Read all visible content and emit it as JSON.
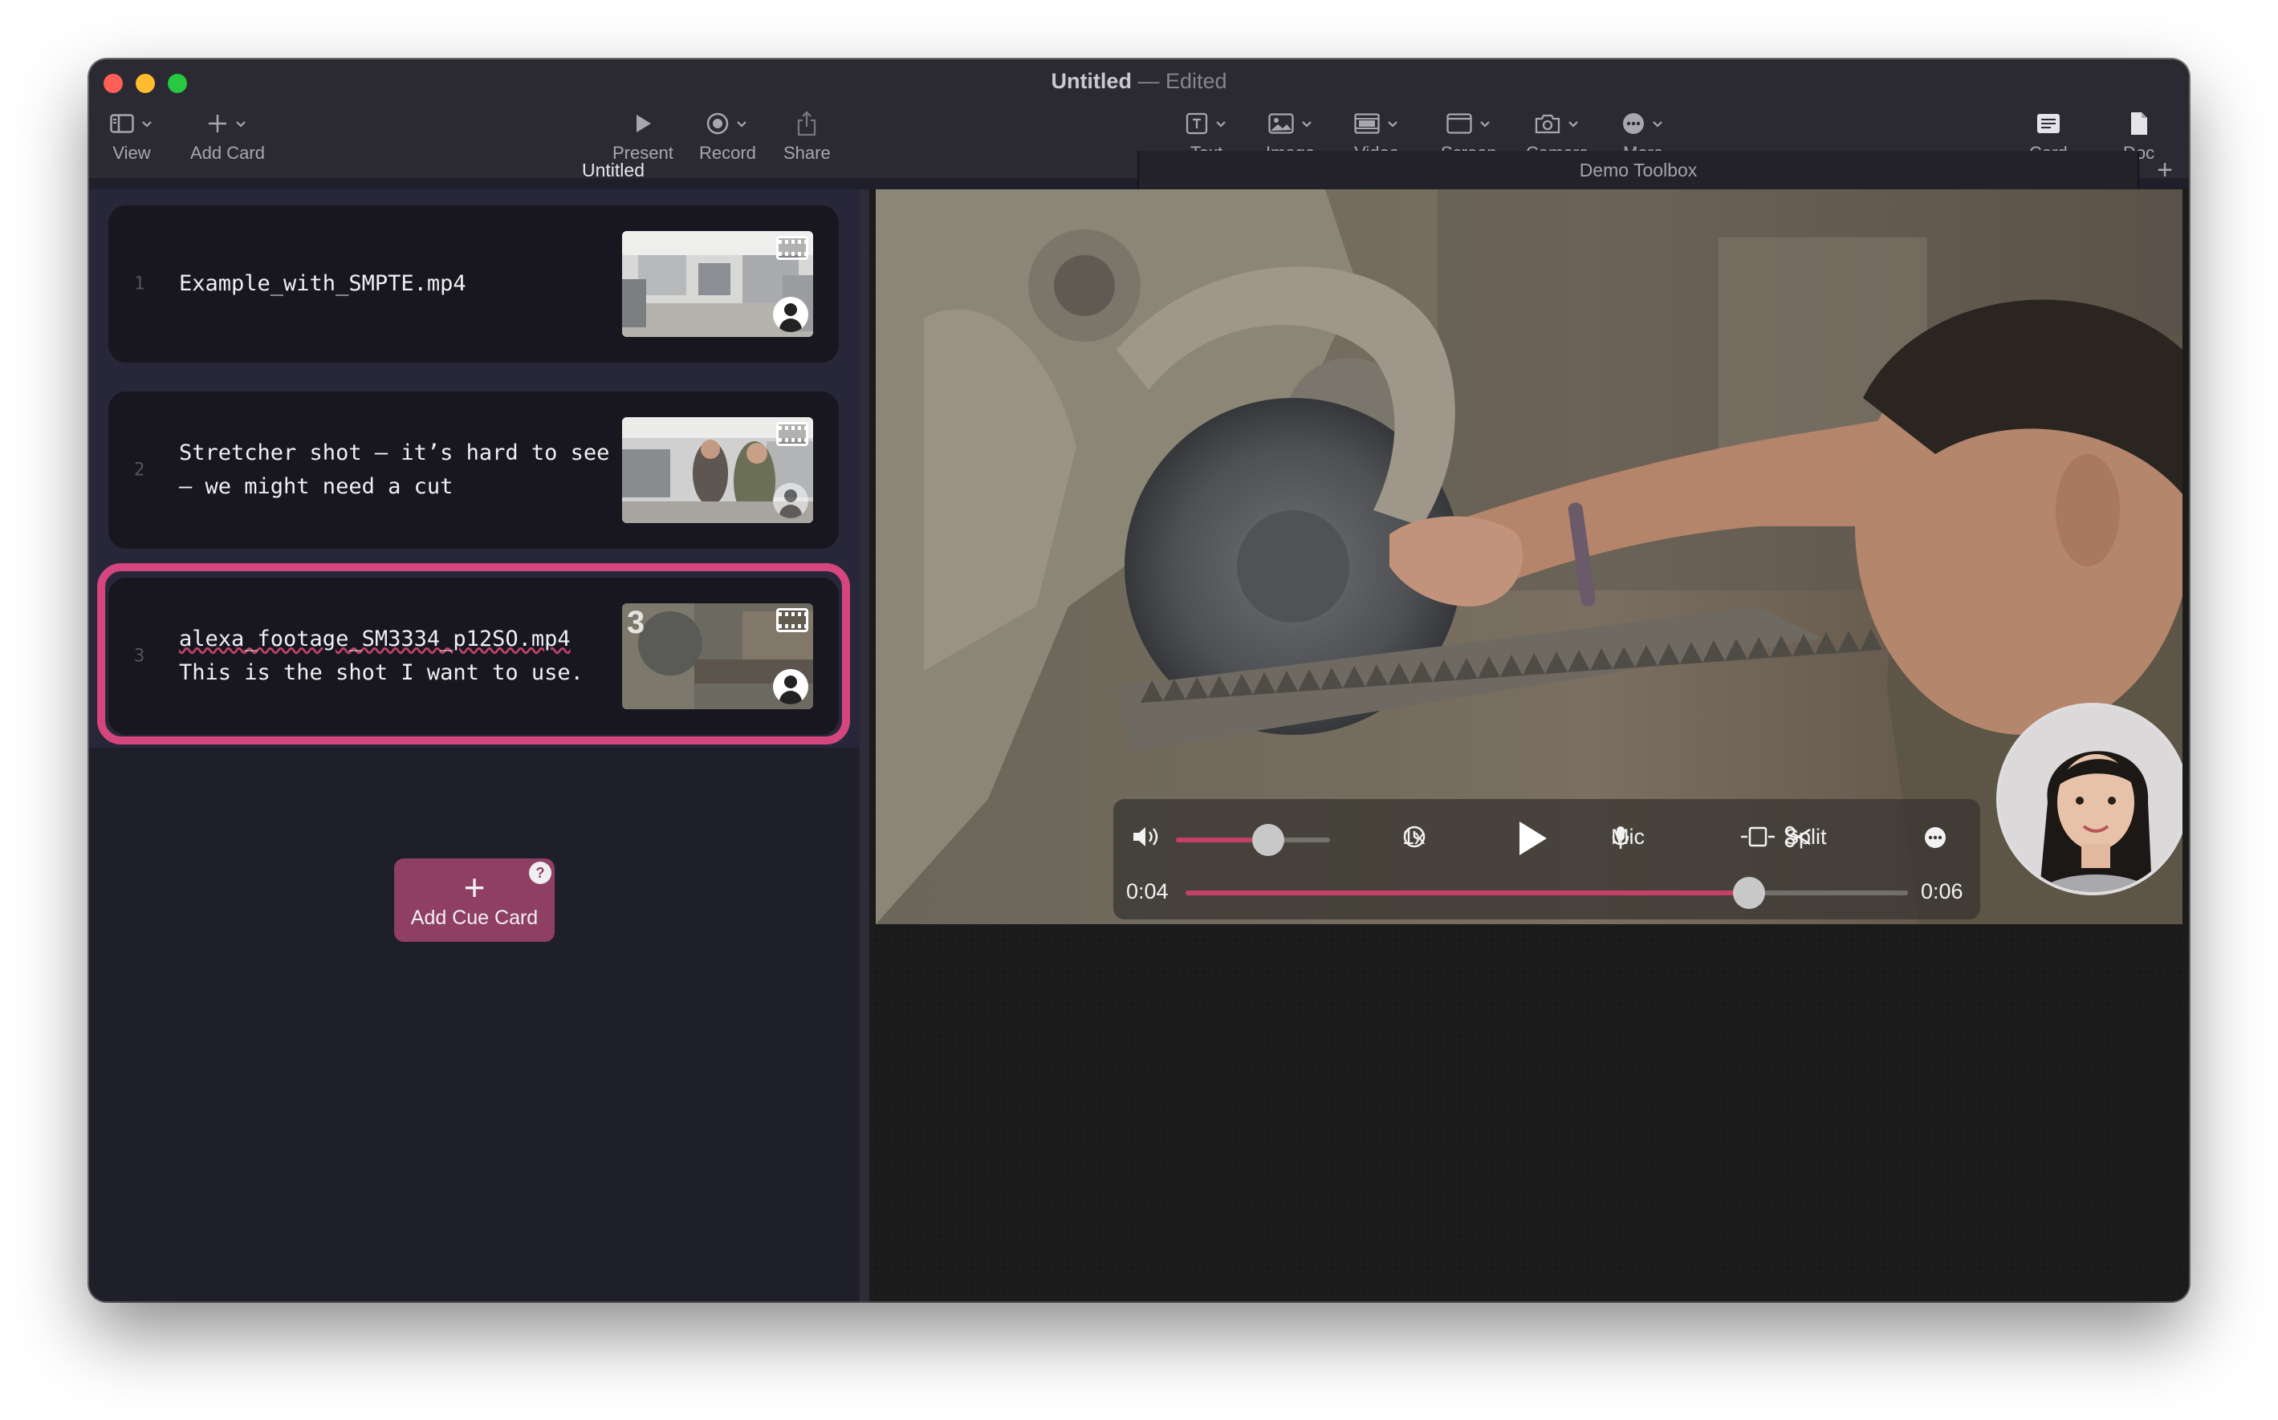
{
  "window": {
    "title": "Untitled",
    "title_separator": "—",
    "title_status": "Edited"
  },
  "toolbar": {
    "view_label": "View",
    "add_card_label": "Add Card",
    "present_label": "Present",
    "record_label": "Record",
    "share_label": "Share",
    "text_label": "Text",
    "image_label": "Image",
    "video_label": "Video",
    "screen_label": "Screen",
    "camera_label": "Camera",
    "more_label": "More",
    "card_label": "Card",
    "doc_label": "Doc"
  },
  "tabs": {
    "left": "Untitled",
    "right": "Demo Toolbox",
    "add": "+"
  },
  "cards": [
    {
      "number": "1",
      "line1": "Example_with_SMPTE.mp4",
      "line2": ""
    },
    {
      "number": "2",
      "line1": "Stretcher shot – it’s hard to see",
      "line2": "– we might need a cut"
    },
    {
      "number": "3",
      "line1": "alexa_footage_SM3334_p12SO.mp4",
      "line2": "This is the shot I want to use.",
      "thumb_badge": "3"
    }
  ],
  "add_cue": {
    "plus": "+",
    "label": "Add Cue Card",
    "help": "?"
  },
  "player": {
    "speed": "1x",
    "mic_label": "Mic",
    "split_label": "Split",
    "current_time": "0:04",
    "duration": "0:06",
    "volume_fraction": 0.6,
    "progress_fraction": 0.78
  },
  "colors": {
    "accent": "#d4467d",
    "add_cue_bg": "#8e3f63",
    "progress": "#c63f68"
  },
  "icons": {
    "view": "sidebar-icon",
    "add_card": "plus-icon",
    "present": "play-icon",
    "record": "record-icon",
    "share": "share-icon",
    "text": "text-box-icon",
    "image": "image-icon",
    "video": "film-icon",
    "screen": "screen-icon",
    "camera": "camera-icon",
    "more": "ellipsis-icon",
    "card": "card-icon",
    "doc": "document-icon"
  }
}
